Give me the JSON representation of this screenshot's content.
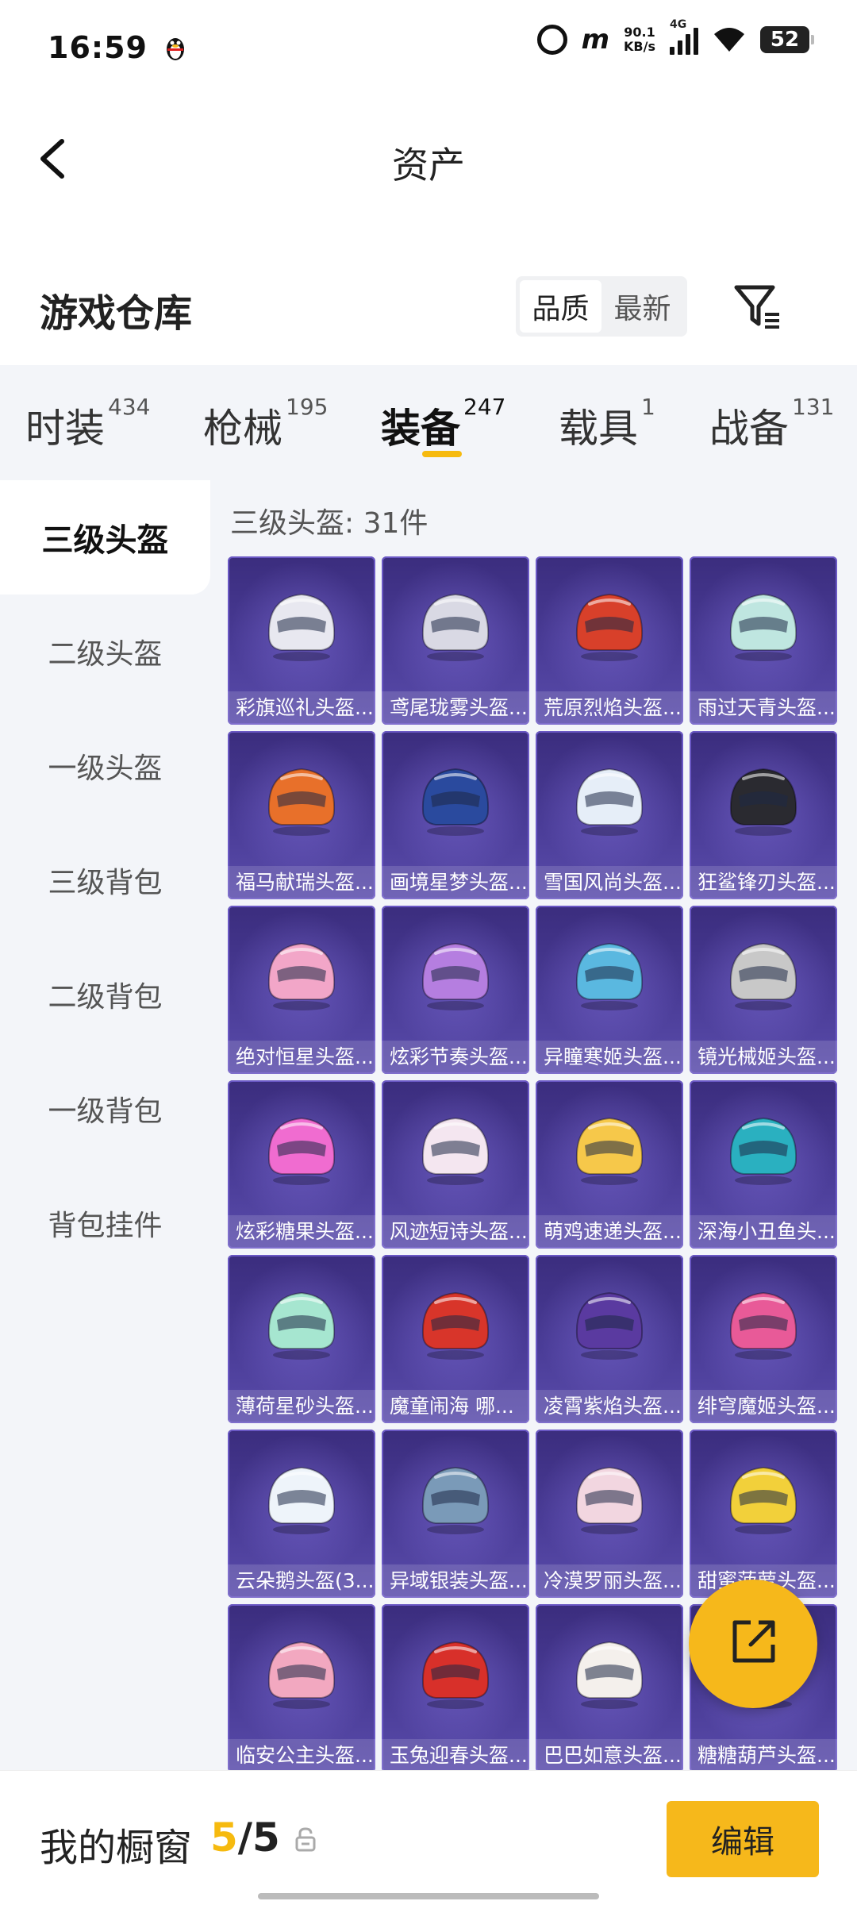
{
  "status_bar": {
    "time": "16:59",
    "net_speed_value": "90.1",
    "net_speed_unit": "KB/s",
    "signal_label": "4G",
    "battery": "52"
  },
  "header": {
    "title": "资产"
  },
  "warehouse": {
    "title": "游戏仓库",
    "sort_options": [
      "品质",
      "最新"
    ],
    "sort_selected": "品质"
  },
  "category_tabs": [
    {
      "label": "时装",
      "count": "434"
    },
    {
      "label": "枪械",
      "count": "195"
    },
    {
      "label": "装备",
      "count": "247",
      "active": true
    },
    {
      "label": "载具",
      "count": "1"
    },
    {
      "label": "战备",
      "count": "131"
    }
  ],
  "sidebar": {
    "items": [
      "三级头盔",
      "二级头盔",
      "一级头盔",
      "三级背包",
      "二级背包",
      "一级背包",
      "背包挂件"
    ],
    "active": "三级头盔"
  },
  "list": {
    "count_label": "三级头盔: 31件",
    "items": [
      {
        "name": "彩旗巡礼头盔...",
        "icon": "helmet-white-clown",
        "color": "#e8e8f0"
      },
      {
        "name": "鸢尾珑雾头盔...",
        "icon": "helmet-silver-veil",
        "color": "#d9d9e4"
      },
      {
        "name": "荒原烈焰头盔...",
        "icon": "helmet-red-dragon",
        "color": "#d8402a"
      },
      {
        "name": "雨过天青头盔...",
        "icon": "helmet-celadon",
        "color": "#bfe6e0"
      },
      {
        "name": "福马献瑞头盔...",
        "icon": "helmet-orange-horse",
        "color": "#e8702a"
      },
      {
        "name": "画境星梦头盔...",
        "icon": "helmet-blue-dragon",
        "color": "#2a4a9e"
      },
      {
        "name": "雪国风尚头盔...",
        "icon": "helmet-white-goggle",
        "color": "#e6eef8"
      },
      {
        "name": "狂鲨锋刃头盔...",
        "icon": "helmet-black-shark",
        "color": "#2a2a30"
      },
      {
        "name": "绝对恒星头盔...",
        "icon": "helmet-pink-bow",
        "color": "#f2a6c8"
      },
      {
        "name": "炫彩节奏头盔...",
        "icon": "helmet-purple-yellow",
        "color": "#b57ee0"
      },
      {
        "name": "异瞳寒姬头盔...",
        "icon": "helmet-cyan-ice",
        "color": "#5ab8e0"
      },
      {
        "name": "镜光械姬头盔...",
        "icon": "helmet-silver-mask",
        "color": "#c8c8c8"
      },
      {
        "name": "炫彩糖果头盔...",
        "icon": "helmet-pink-candy",
        "color": "#f06cd0"
      },
      {
        "name": "风迹短诗头盔...",
        "icon": "helmet-white-pink",
        "color": "#f4e6f0"
      },
      {
        "name": "萌鸡速递头盔...",
        "icon": "helmet-yellow-chick",
        "color": "#f6c84a"
      },
      {
        "name": "深海小丑鱼头...",
        "icon": "helmet-teal-fish",
        "color": "#2ab0c0"
      },
      {
        "name": "薄荷星砂头盔...",
        "icon": "helmet-mint",
        "color": "#a6e6d0"
      },
      {
        "name": "魔童闹海 哪...",
        "icon": "helmet-red-gold",
        "color": "#d8352a"
      },
      {
        "name": "凌霄紫焰头盔...",
        "icon": "helmet-purple-flame",
        "color": "#5a3aa0"
      },
      {
        "name": "绯穹魔姬头盔...",
        "icon": "helmet-pink-cat",
        "color": "#e85a98"
      },
      {
        "name": "云朵鹅头盔(3...",
        "icon": "helmet-white-goose",
        "color": "#eef4fa"
      },
      {
        "name": "异域银装头盔...",
        "icon": "helmet-silver-blue",
        "color": "#7a9ab8"
      },
      {
        "name": "冷漠罗丽头盔...",
        "icon": "helmet-white-rose",
        "color": "#f2d6e0"
      },
      {
        "name": "甜蜜菠萝头盔...",
        "icon": "helmet-pineapple",
        "color": "#f2d03a"
      },
      {
        "name": "临安公主头盔...",
        "icon": "helmet-pink-princess",
        "color": "#f2a8c0"
      },
      {
        "name": "玉兔迎春头盔...",
        "icon": "helmet-red-rabbit",
        "color": "#d8302a"
      },
      {
        "name": "巴巴如意头盔...",
        "icon": "helmet-white-orange",
        "color": "#f4f0ec"
      },
      {
        "name": "糖糖葫芦头盔...",
        "icon": "helmet-gourd",
        "color": "#e84a4a"
      }
    ]
  },
  "showcase": {
    "title": "我的橱窗",
    "current": "5",
    "separator_total": "/5",
    "edit_label": "编辑"
  },
  "colors": {
    "accent": "#f6ba0f",
    "card_bg": "#4a3c97"
  }
}
